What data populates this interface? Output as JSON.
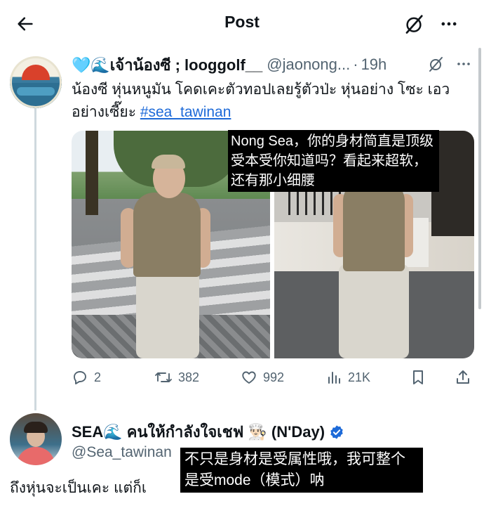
{
  "header": {
    "title": "Post"
  },
  "tweet1": {
    "name": "🩵🌊เจ้าน้องซี ; looggolf__",
    "handle": "@jaonong...",
    "time": "19h",
    "text": "น้องซี หุ่นหนูมัน โคดเคะตัวทอปเลยรู้ตัวป่ะ หุ่นอย่าง โซะ เอวอย่างเซี๊ยะ ",
    "hashtag": "#sea_tawinan",
    "subtitle": "Nong Sea，你的身材简直是顶级受本受你知道吗？看起来超软，还有那小细腰",
    "stats": {
      "replies": "2",
      "reposts": "382",
      "likes": "992",
      "views": "21K"
    }
  },
  "tweet2": {
    "name": "SEA🌊 คนให้กำลังใจเชฟ 👨🏻‍🍳 (N'Day)",
    "handle": "@Sea_tawinan",
    "text": "ถึงหุ่นจะเป็นเคะ แต่ก็เ",
    "subtitle": "不只是身材是受属性哦，我可整个是受mode（模式）呐"
  },
  "colors": {
    "hashtag": "#1d6ad8",
    "secondary_text": "#536471",
    "verified": "#1d6ad8"
  }
}
